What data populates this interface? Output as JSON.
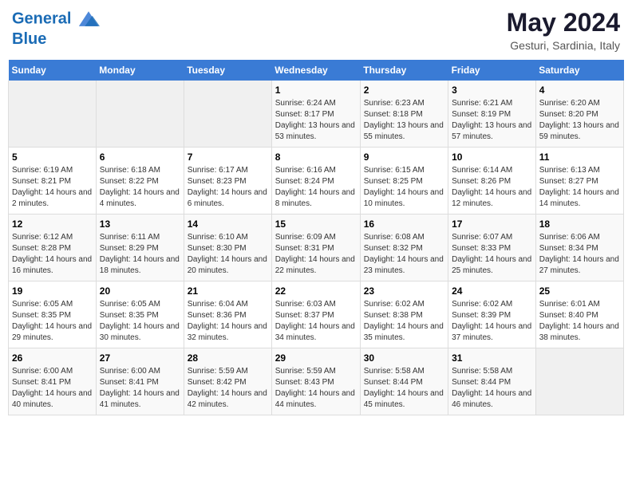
{
  "logo": {
    "line1": "General",
    "line2": "Blue"
  },
  "title": {
    "month_year": "May 2024",
    "location": "Gesturi, Sardinia, Italy"
  },
  "days_of_week": [
    "Sunday",
    "Monday",
    "Tuesday",
    "Wednesday",
    "Thursday",
    "Friday",
    "Saturday"
  ],
  "weeks": [
    [
      {
        "num": "",
        "info": ""
      },
      {
        "num": "",
        "info": ""
      },
      {
        "num": "",
        "info": ""
      },
      {
        "num": "1",
        "info": "Sunrise: 6:24 AM\nSunset: 8:17 PM\nDaylight: 13 hours and 53 minutes."
      },
      {
        "num": "2",
        "info": "Sunrise: 6:23 AM\nSunset: 8:18 PM\nDaylight: 13 hours and 55 minutes."
      },
      {
        "num": "3",
        "info": "Sunrise: 6:21 AM\nSunset: 8:19 PM\nDaylight: 13 hours and 57 minutes."
      },
      {
        "num": "4",
        "info": "Sunrise: 6:20 AM\nSunset: 8:20 PM\nDaylight: 13 hours and 59 minutes."
      }
    ],
    [
      {
        "num": "5",
        "info": "Sunrise: 6:19 AM\nSunset: 8:21 PM\nDaylight: 14 hours and 2 minutes."
      },
      {
        "num": "6",
        "info": "Sunrise: 6:18 AM\nSunset: 8:22 PM\nDaylight: 14 hours and 4 minutes."
      },
      {
        "num": "7",
        "info": "Sunrise: 6:17 AM\nSunset: 8:23 PM\nDaylight: 14 hours and 6 minutes."
      },
      {
        "num": "8",
        "info": "Sunrise: 6:16 AM\nSunset: 8:24 PM\nDaylight: 14 hours and 8 minutes."
      },
      {
        "num": "9",
        "info": "Sunrise: 6:15 AM\nSunset: 8:25 PM\nDaylight: 14 hours and 10 minutes."
      },
      {
        "num": "10",
        "info": "Sunrise: 6:14 AM\nSunset: 8:26 PM\nDaylight: 14 hours and 12 minutes."
      },
      {
        "num": "11",
        "info": "Sunrise: 6:13 AM\nSunset: 8:27 PM\nDaylight: 14 hours and 14 minutes."
      }
    ],
    [
      {
        "num": "12",
        "info": "Sunrise: 6:12 AM\nSunset: 8:28 PM\nDaylight: 14 hours and 16 minutes."
      },
      {
        "num": "13",
        "info": "Sunrise: 6:11 AM\nSunset: 8:29 PM\nDaylight: 14 hours and 18 minutes."
      },
      {
        "num": "14",
        "info": "Sunrise: 6:10 AM\nSunset: 8:30 PM\nDaylight: 14 hours and 20 minutes."
      },
      {
        "num": "15",
        "info": "Sunrise: 6:09 AM\nSunset: 8:31 PM\nDaylight: 14 hours and 22 minutes."
      },
      {
        "num": "16",
        "info": "Sunrise: 6:08 AM\nSunset: 8:32 PM\nDaylight: 14 hours and 23 minutes."
      },
      {
        "num": "17",
        "info": "Sunrise: 6:07 AM\nSunset: 8:33 PM\nDaylight: 14 hours and 25 minutes."
      },
      {
        "num": "18",
        "info": "Sunrise: 6:06 AM\nSunset: 8:34 PM\nDaylight: 14 hours and 27 minutes."
      }
    ],
    [
      {
        "num": "19",
        "info": "Sunrise: 6:05 AM\nSunset: 8:35 PM\nDaylight: 14 hours and 29 minutes."
      },
      {
        "num": "20",
        "info": "Sunrise: 6:05 AM\nSunset: 8:35 PM\nDaylight: 14 hours and 30 minutes."
      },
      {
        "num": "21",
        "info": "Sunrise: 6:04 AM\nSunset: 8:36 PM\nDaylight: 14 hours and 32 minutes."
      },
      {
        "num": "22",
        "info": "Sunrise: 6:03 AM\nSunset: 8:37 PM\nDaylight: 14 hours and 34 minutes."
      },
      {
        "num": "23",
        "info": "Sunrise: 6:02 AM\nSunset: 8:38 PM\nDaylight: 14 hours and 35 minutes."
      },
      {
        "num": "24",
        "info": "Sunrise: 6:02 AM\nSunset: 8:39 PM\nDaylight: 14 hours and 37 minutes."
      },
      {
        "num": "25",
        "info": "Sunrise: 6:01 AM\nSunset: 8:40 PM\nDaylight: 14 hours and 38 minutes."
      }
    ],
    [
      {
        "num": "26",
        "info": "Sunrise: 6:00 AM\nSunset: 8:41 PM\nDaylight: 14 hours and 40 minutes."
      },
      {
        "num": "27",
        "info": "Sunrise: 6:00 AM\nSunset: 8:41 PM\nDaylight: 14 hours and 41 minutes."
      },
      {
        "num": "28",
        "info": "Sunrise: 5:59 AM\nSunset: 8:42 PM\nDaylight: 14 hours and 42 minutes."
      },
      {
        "num": "29",
        "info": "Sunrise: 5:59 AM\nSunset: 8:43 PM\nDaylight: 14 hours and 44 minutes."
      },
      {
        "num": "30",
        "info": "Sunrise: 5:58 AM\nSunset: 8:44 PM\nDaylight: 14 hours and 45 minutes."
      },
      {
        "num": "31",
        "info": "Sunrise: 5:58 AM\nSunset: 8:44 PM\nDaylight: 14 hours and 46 minutes."
      },
      {
        "num": "",
        "info": ""
      }
    ]
  ]
}
